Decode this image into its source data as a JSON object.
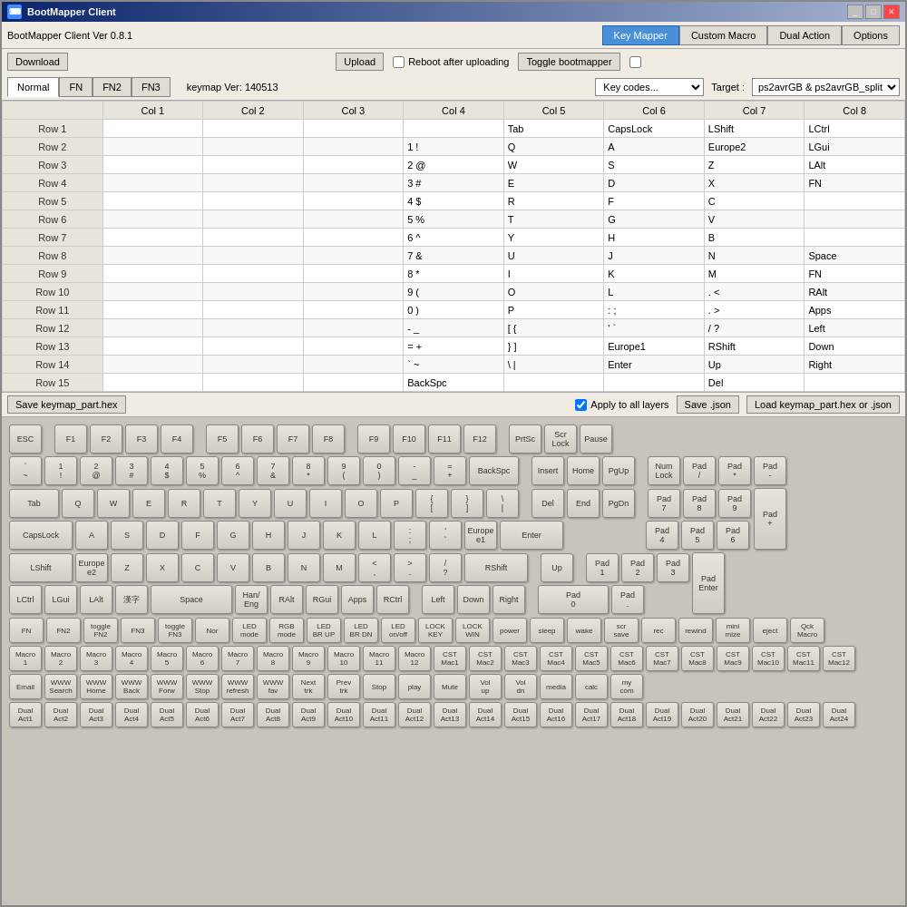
{
  "window": {
    "title": "BootMapper Client",
    "icon": "⌨"
  },
  "top_tabs": [
    {
      "label": "Key Mapper",
      "active": true
    },
    {
      "label": "Custom Macro",
      "active": false
    },
    {
      "label": "Dual Action",
      "active": false
    },
    {
      "label": "Options",
      "active": false
    }
  ],
  "toolbar": {
    "version": "BootMapper Client Ver 0.8.1",
    "download_label": "Download",
    "upload_label": "Upload",
    "reboot_label": "Reboot after uploading",
    "toggle_label": "Toggle bootmapper"
  },
  "tabs": {
    "normal": "Normal",
    "fn": "FN",
    "fn2": "FN2",
    "fn3": "FN3",
    "keymap_ver": "keymap Ver: 140513",
    "key_codes": "Key codes...",
    "target_label": "Target :",
    "target_value": "ps2avrGB & ps2avrGB_split"
  },
  "table": {
    "cols": [
      "",
      "Col 1",
      "Col 2",
      "Col 3",
      "Col 4",
      "Col 5",
      "Col 6",
      "Col 7",
      "Col 8"
    ],
    "rows": [
      {
        "label": "Row 1",
        "cells": [
          "",
          "",
          "",
          "",
          "Tab",
          "CapsLock",
          "LShift",
          "LCtrl"
        ]
      },
      {
        "label": "Row 2",
        "cells": [
          "",
          "",
          "",
          "1 !",
          "Q",
          "A",
          "Europe2",
          "LGui"
        ]
      },
      {
        "label": "Row 3",
        "cells": [
          "",
          "",
          "",
          "2 @",
          "W",
          "S",
          "Z",
          "LAlt"
        ]
      },
      {
        "label": "Row 4",
        "cells": [
          "",
          "",
          "",
          "3 #",
          "E",
          "D",
          "X",
          "FN"
        ]
      },
      {
        "label": "Row 5",
        "cells": [
          "",
          "",
          "",
          "4 $",
          "R",
          "F",
          "C",
          ""
        ]
      },
      {
        "label": "Row 6",
        "cells": [
          "",
          "",
          "",
          "5 %",
          "T",
          "G",
          "V",
          ""
        ]
      },
      {
        "label": "Row 7",
        "cells": [
          "",
          "",
          "",
          "6 ^",
          "Y",
          "H",
          "B",
          ""
        ]
      },
      {
        "label": "Row 8",
        "cells": [
          "",
          "",
          "",
          "7 &",
          "U",
          "J",
          "N",
          "Space"
        ]
      },
      {
        "label": "Row 9",
        "cells": [
          "",
          "",
          "",
          "8 *",
          "I",
          "K",
          "M",
          "FN"
        ]
      },
      {
        "label": "Row 10",
        "cells": [
          "",
          "",
          "",
          "9 (",
          "O",
          "L",
          ". <",
          "RAlt"
        ]
      },
      {
        "label": "Row 11",
        "cells": [
          "",
          "",
          "",
          "0 )",
          "P",
          ": ;",
          ". >",
          "Apps"
        ]
      },
      {
        "label": "Row 12",
        "cells": [
          "",
          "",
          "",
          "- _",
          "[ {",
          "' `",
          "/ ?",
          "Left"
        ]
      },
      {
        "label": "Row 13",
        "cells": [
          "",
          "",
          "",
          "= +",
          "} ]",
          "Europe1",
          "RShift",
          "Down"
        ]
      },
      {
        "label": "Row 14",
        "cells": [
          "",
          "",
          "",
          "` ~",
          "\\ |",
          "Enter",
          "Up",
          "Right"
        ]
      },
      {
        "label": "Row 15",
        "cells": [
          "",
          "",
          "",
          "BackSpc",
          "",
          "",
          "Del",
          ""
        ]
      }
    ]
  },
  "bottom_bar": {
    "save_hex": "Save keymap_part.hex",
    "apply_all": "Apply to all layers",
    "save_json": "Save .json",
    "load_hex": "Load keymap_part.hex or .json"
  },
  "keyboard": {
    "row_fn": [
      "ESC",
      "F1",
      "F2",
      "F3",
      "F4",
      "F5",
      "F6",
      "F7",
      "F8",
      "F9",
      "F10",
      "F11",
      "F12",
      "PrtSc",
      "Scr\nLock",
      "Pause"
    ],
    "row_num": [
      "` ~",
      "1\n!",
      "2\n@",
      "3\n#",
      "4\n$",
      "5\n%",
      "6\n^",
      "7\n&",
      "8\n*",
      "9\n(",
      "0\n)",
      "- _",
      "= +",
      "BackSpc",
      "Insert",
      "Home",
      "PgUp"
    ],
    "row_tab": [
      "Tab",
      "Q",
      "W",
      "E",
      "R",
      "T",
      "Y",
      "U",
      "I",
      "O",
      "P",
      "[ {",
      "} ]",
      "\\ |",
      "Del",
      "End",
      "PgDn"
    ],
    "row_caps": [
      "CapsLock",
      "A",
      "S",
      "D",
      "F",
      "G",
      "H",
      "J",
      "K",
      "L",
      ": ;",
      "' `",
      "Europe\ne1",
      "Enter"
    ],
    "row_shift": [
      "LShift",
      "Europe\ne2",
      "Z",
      "X",
      "C",
      "V",
      "B",
      "N",
      "M",
      "< ,",
      "> .",
      "/ ?",
      "RShift",
      "Up"
    ],
    "row_ctrl": [
      "LCtrl",
      "LGui",
      "LAlt",
      "漢字",
      "Space",
      "Han/\nEng",
      "RAlt",
      "RGui",
      "Apps",
      "RCtrl",
      "Left",
      "Down",
      "Right"
    ],
    "row_fn_extra": [
      "FN",
      "FN2",
      "toggle\nFN2",
      "FN3",
      "toggle\nFN3",
      "Nor",
      "LED\nmode",
      "RGB\nmode",
      "LED\nBR UP",
      "LED\nBR DN",
      "LED\non/off",
      "LOCK\nKEY",
      "LOCK\nWIN",
      "power",
      "sleep",
      "wake",
      "scr\nsave",
      "rec",
      "rewind",
      "mini\nmize",
      "eject",
      "Qck\nMacro"
    ],
    "row_cst": [
      "Macro\n1",
      "Macro\n2",
      "Macro\n3",
      "Macro\n4",
      "Macro\n5",
      "Macro\n6",
      "Macro\n7",
      "Macro\n8",
      "Macro\n9",
      "Macro\n10",
      "Macro\n11",
      "Macro\n12",
      "CST\nMac1",
      "CST\nMac2",
      "CST\nMac3",
      "CST\nMac4",
      "CST\nMac5",
      "CST\nMac6",
      "CST\nMac7",
      "CST\nMac8",
      "CST\nMac9",
      "CST\nMac10",
      "CST\nMac11",
      "CST\nMac12"
    ],
    "row_media": [
      "Email",
      "WWW\nSearch",
      "WWW\nHome",
      "WWW\nBack",
      "WWW\nForw",
      "WWW\nStop",
      "WWW\nrefresh",
      "WWW\nfav",
      "Next\ntrk",
      "Prev\ntrk",
      "Stop",
      "play",
      "Mute",
      "Vol\nup",
      "Vol\ndn",
      "media",
      "calc",
      "my\ncom"
    ],
    "row_dual": [
      "Dual\nAct1",
      "Dual\nAct2",
      "Dual\nAct3",
      "Dual\nAct4",
      "Dual\nAct5",
      "Dual\nAct6",
      "Dual\nAct7",
      "Dual\nAct8",
      "Dual\nAct9",
      "Dual\nAct10",
      "Dual\nAct11",
      "Dual\nAct12",
      "Dual\nAct13",
      "Dual\nAct14",
      "Dual\nAct15",
      "Dual\nAct16",
      "Dual\nAct17",
      "Dual\nAct18",
      "Dual\nAct19",
      "Dual\nAct20",
      "Dual\nAct21",
      "Dual\nAct22",
      "Dual\nAct23",
      "Dual\nAct24"
    ],
    "numpad": {
      "top": [
        "Num\nLock",
        "Pad\n/",
        "Pad\n*",
        "Pad\n-"
      ],
      "row1": [
        "Pad\n7",
        "Pad\n8",
        "Pad\n9"
      ],
      "row2": [
        "Pad\n4",
        "Pad\n5",
        "Pad\n6"
      ],
      "row3": [
        "Pad\n1",
        "Pad\n2",
        "Pad\n3"
      ],
      "row4": [
        "Pad\n0"
      ],
      "special": [
        "Pad\n+",
        "Pad\nEnter",
        "Pad\n."
      ]
    }
  }
}
